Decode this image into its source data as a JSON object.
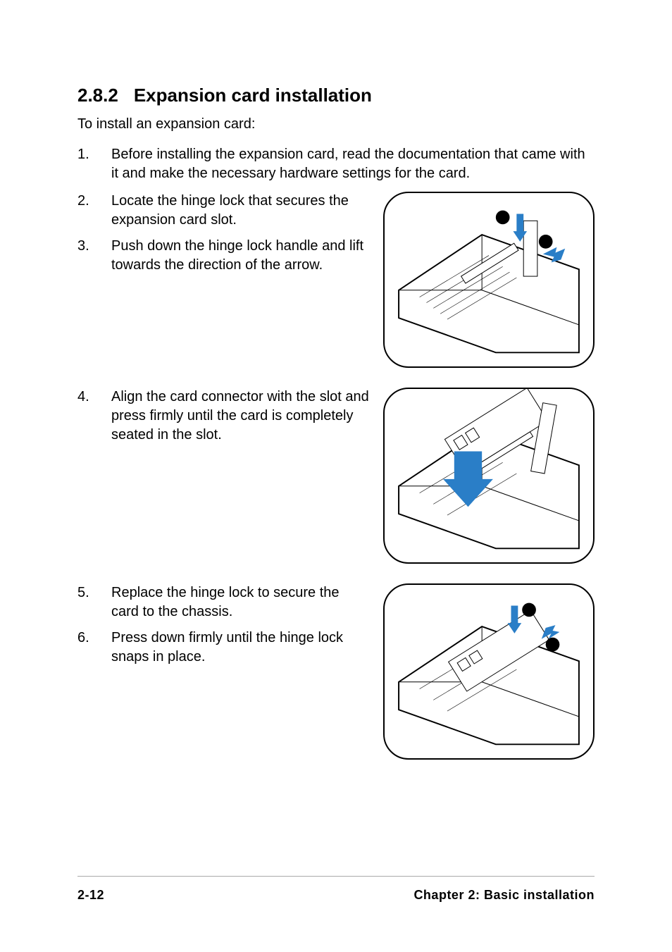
{
  "heading": {
    "number": "2.8.2",
    "title": "Expansion card installation"
  },
  "intro": "To install an expansion card:",
  "steps": {
    "s1": {
      "num": "1.",
      "text": "Before installing the expansion card, read the documentation that came with it and make the necessary hardware settings for the card."
    },
    "s2": {
      "num": "2.",
      "text": "Locate the hinge lock that secures the expansion card slot."
    },
    "s3": {
      "num": "3.",
      "text": "Push down the hinge lock handle and lift towards the direction of the arrow."
    },
    "s4": {
      "num": "4.",
      "text": "Align the card connector with the slot and press firmly until the card is completely seated in the slot."
    },
    "s5": {
      "num": "5.",
      "text": "Replace the hinge lock to secure the card to the chassis."
    },
    "s6": {
      "num": "6.",
      "text": "Press down firmly until the hinge lock snaps in place."
    }
  },
  "illustrations": {
    "fig1_alt": "Hinge lock being pushed down and lifted outward on chassis",
    "fig2_alt": "Expansion card being aligned and pressed into slot",
    "fig3_alt": "Hinge lock replaced and pressed down to snap in place"
  },
  "footer": {
    "page": "2-12",
    "chapter": "Chapter 2: Basic installation"
  },
  "colors": {
    "arrow": "#2a7ec7"
  }
}
